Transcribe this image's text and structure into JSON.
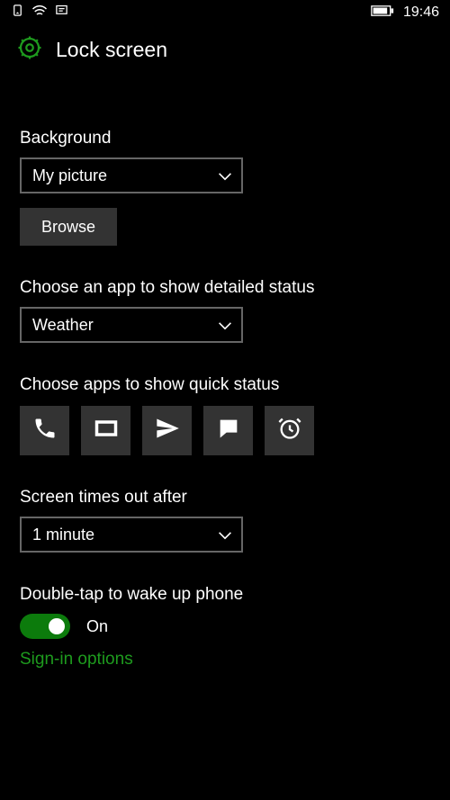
{
  "status": {
    "time": "19:46"
  },
  "header": {
    "title": "Lock screen"
  },
  "background": {
    "label": "Background",
    "value": "My picture",
    "browse": "Browse"
  },
  "detailed": {
    "label": "Choose an app to show detailed status",
    "value": "Weather"
  },
  "quick": {
    "label": "Choose apps to show quick status",
    "items": [
      "phone",
      "mail-box",
      "paper-plane",
      "messaging",
      "alarm"
    ]
  },
  "timeout": {
    "label": "Screen times out after",
    "value": "1 minute"
  },
  "doubletap": {
    "label": "Double-tap to wake up phone",
    "state": "On"
  },
  "signin": {
    "label": "Sign-in options"
  }
}
